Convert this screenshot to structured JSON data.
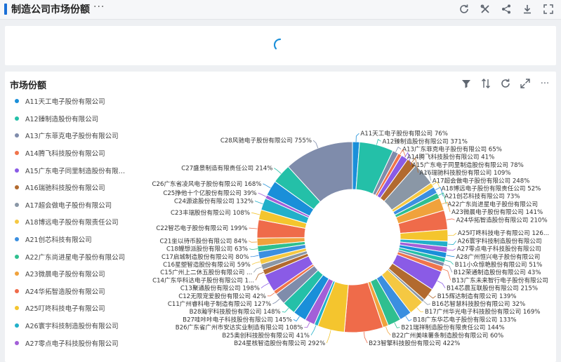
{
  "header": {
    "title": "制造公司市场份额",
    "more": "···"
  },
  "header_icons": [
    "refresh-icon",
    "tools-icon",
    "share-icon",
    "download-icon",
    "fullscreen-icon"
  ],
  "panel": {
    "title": "市场份额",
    "more": "···"
  },
  "panel_icons": [
    "filter-icon",
    "sort-icon",
    "refresh-icon",
    "expand-icon"
  ],
  "chart_data": {
    "type": "pie",
    "title": "市场份额",
    "inner_radius_ratio": 0.5,
    "legend_position": "left",
    "labels": [
      {
        "name": "A11天工电子股份有限公司",
        "value": 76,
        "text": "76%"
      },
      {
        "name": "A12臻制造股份有限公司",
        "value": 371,
        "text": "371%"
      },
      {
        "name": "A13广东菲克电子股份有限公司",
        "value": 65,
        "text": "65%"
      },
      {
        "name": "A14腾飞科技股份有限公司",
        "value": 41,
        "text": "41%"
      },
      {
        "name": "A15广东电子同里制造股份有限公司",
        "value": 78,
        "text": "78%"
      },
      {
        "name": "A16瑞驰科技股份有限公司",
        "value": 109,
        "text": "109%"
      },
      {
        "name": "A17超会做电子股份有限公司",
        "value": 248,
        "text": "248%"
      },
      {
        "name": "A18博远电子股份有限责任公司",
        "value": 52,
        "text": "52%"
      },
      {
        "name": "A21创芯科技有限公司",
        "value": 73,
        "text": "73%"
      },
      {
        "name": "A22广东尚进星电子股份有限公司",
        "value": null,
        "text": ""
      },
      {
        "name": "A23微晨电子股份有限公司",
        "value": 141,
        "text": "141%"
      },
      {
        "name": "A24华拓智造股份有限公司",
        "value": 210,
        "text": "210%"
      },
      {
        "name": "A25叮咚科技电子有限公司",
        "value": 126,
        "text": "126..."
      },
      {
        "name": "A26寰宇科技制造股份有限公司",
        "value": null,
        "text": ""
      },
      {
        "name": "A27零点电子科技股份有限公司",
        "value": null,
        "text": ""
      },
      {
        "name": "A28广州恒兴电子股份有限公司",
        "value": null,
        "text": ""
      },
      {
        "name": "B11小众惊艳股份有限公司",
        "value": 51,
        "text": "51%"
      },
      {
        "name": "B12荣通制造股份有限公司",
        "value": 43,
        "text": "43%"
      },
      {
        "name": "B13广东未来智行电子股份有限公司",
        "value": null,
        "text": ""
      },
      {
        "name": "B14芯晨互联股份有限公司",
        "value": 215,
        "text": "215%"
      },
      {
        "name": "B15辉达制造有限公司",
        "value": 139,
        "text": "139%"
      },
      {
        "name": "B16芯智慧科技股份有限公司",
        "value": 32,
        "text": "32%"
      },
      {
        "name": "B17广州华光电子科技股份有限公司",
        "value": 169,
        "text": "169%"
      },
      {
        "name": "B18广东华芯电子股份有限公司",
        "value": 133,
        "text": "133%"
      },
      {
        "name": "B21瑞祥制造股份有限责任公司",
        "value": 144,
        "text": "144%"
      },
      {
        "name": "B22广州美味薯条制造股份有限公司",
        "value": 60,
        "text": "60%"
      },
      {
        "name": "B23智擎科技股份有限公司",
        "value": 422,
        "text": "422%"
      },
      {
        "name": "B24星核智造股份有限公司",
        "value": 292,
        "text": "292%"
      },
      {
        "name": "B25奥创科技股份有限公司",
        "value": 41,
        "text": "41%"
      },
      {
        "name": "B26广东省广州市安达实业制造有限公司",
        "value": 108,
        "text": "108%"
      },
      {
        "name": "B27哇咔咔电子科技股份有限公司",
        "value": 145,
        "text": "145%"
      },
      {
        "name": "B28瀚宇科技股份有限公司",
        "value": 148,
        "text": "148%"
      },
      {
        "name": "C11广州睿科电子制造有限公司",
        "value": 127,
        "text": "127%"
      },
      {
        "name": "C12无限宠爱股份有限公司",
        "value": 42,
        "text": "42%"
      },
      {
        "name": "C13聚通股份有限公司",
        "value": 198,
        "text": "198%"
      },
      {
        "name": "C14广东华科达电子股份有限公司",
        "value": null,
        "text": "1..."
      },
      {
        "name": "C15广州上二休五股份有限公司",
        "value": null,
        "text": "..."
      },
      {
        "name": "C16星塑智造股份有限公司",
        "value": 59,
        "text": "59%"
      },
      {
        "name": "C17启城制造股份有限公司",
        "value": 80,
        "text": "80%"
      },
      {
        "name": "C18鲤想派股份有限公司",
        "value": 63,
        "text": "63%"
      },
      {
        "name": "C21坐以待币股份有限公司",
        "value": 84,
        "text": "84%"
      },
      {
        "name": "C22智芯电子股份有限公司",
        "value": 199,
        "text": "199%"
      },
      {
        "name": "C23丰瑞股份有限公司",
        "value": 108,
        "text": "108%"
      },
      {
        "name": "C24源途股份有限公司",
        "value": 132,
        "text": "132%"
      },
      {
        "name": "C25挣他十个亿股份有限公司",
        "value": 39,
        "text": "39%"
      },
      {
        "name": "C26广东省凌风电子股份有限公司",
        "value": 168,
        "text": "168%"
      },
      {
        "name": "C27盛景制造有限责任公司",
        "value": 214,
        "text": "214%"
      },
      {
        "name": "C28风驰电子股份有限公司",
        "value": 755,
        "text": "755%"
      }
    ],
    "legend_items": [
      "A11天工电子股份有限公司",
      "A12臻制造股份有限公司",
      "A13广东菲克电子股份有限公司",
      "A14腾飞科技股份有限公司",
      "A15广东电子同里制造股份有限公司",
      "A16瑞驰科技股份有限公司",
      "A17超会做电子股份有限公司",
      "A18博远电子股份有限责任公司",
      "A21创芯科技有限公司",
      "A22广东尚进星电子股份有限公司",
      "A23微晨电子股份有限公司",
      "A24华拓智造股份有限公司",
      "A25叮咚科技电子有限公司",
      "A26寰宇科技制造股份有限公司",
      "A27零点电子科技股份有限公司"
    ],
    "legend_display": [
      "A11天工电子股份有限公司",
      "A12臻制造股份有限公司",
      "A13广东菲克电子股份有限公司",
      "A14腾飞科技股份有限公司",
      "A15广东电子同里制造股份有限公...",
      "A16瑞驰科技股份有限公司",
      "A17超会做电子股份有限公司",
      "A18博远电子股份有限责任公司",
      "A21创芯科技有限公司",
      "A22广东尚进星电子股份有限公司",
      "A23微晨电子股份有限公司",
      "A24华拓智造股份有限公司",
      "A25叮咚科技电子有限公司",
      "A26寰宇科技制造股份有限公司",
      "A27零点电子科技股份有限公司"
    ],
    "colors": [
      "#1a8fd9",
      "#24c0a8",
      "#7f8cab",
      "#f0744b",
      "#8a5be6",
      "#b26a2f",
      "#8a97a6",
      "#f5c842",
      "#3b8fe0",
      "#2fbf8f",
      "#f0a23c",
      "#ef6b4a",
      "#f4c52e",
      "#22b0c9",
      "#a35fd8"
    ]
  }
}
